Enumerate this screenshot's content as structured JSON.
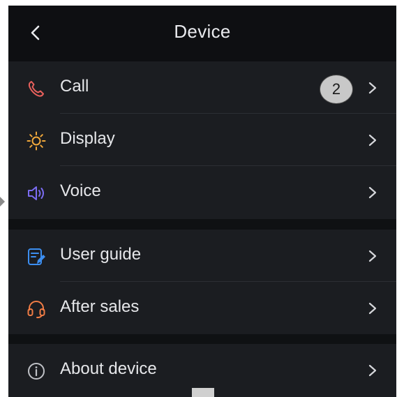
{
  "header": {
    "title": "Device"
  },
  "groups": [
    {
      "items": [
        {
          "label": "Call",
          "icon": "phone-icon",
          "badge": "2"
        },
        {
          "label": "Display",
          "icon": "sun-icon"
        },
        {
          "label": "Voice",
          "icon": "speaker-icon"
        }
      ]
    },
    {
      "items": [
        {
          "label": "User guide",
          "icon": "guide-icon"
        },
        {
          "label": "After sales",
          "icon": "headset-icon"
        }
      ]
    },
    {
      "items": [
        {
          "label": "About device",
          "icon": "info-icon"
        }
      ]
    }
  ],
  "colors": {
    "background": "#0f1113",
    "row": "#1b1d21",
    "phone": "#e8605c",
    "sun": "#f2a93b",
    "speaker": "#7b6cf2",
    "guide": "#3c8ef0",
    "headset": "#f07c45",
    "info": "#bfc1c6"
  }
}
